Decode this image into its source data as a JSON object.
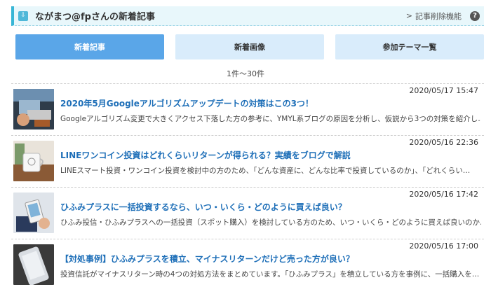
{
  "header": {
    "title": "ながまつ@fpさんの新着記事",
    "delete_link": "記事削除機能",
    "help": "?",
    "arrow": ">"
  },
  "tabs": [
    {
      "label": "新着記事",
      "active": true
    },
    {
      "label": "新着画像",
      "active": false
    },
    {
      "label": "参加テーマ一覧",
      "active": false
    }
  ],
  "range_text": "1件〜30件",
  "articles": [
    {
      "date": "2020/05/17 15:47",
      "title": "2020年5月Googleアルゴリズムアップデートの対策はこの3つ！",
      "desc": "Googleアルゴリズム変更で大きくアクセス下落した方の参考に、YMYL系ブログの原因を分析し、仮説から3つの対策を紹介し…"
    },
    {
      "date": "2020/05/16 22:36",
      "title": "LINEワンコイン投資はどれくらいリターンが得られる？実績をブログで解説",
      "desc": "LINEスマート投資・ワンコイン投資を検討中の方のため、「どんな資産に、どんな比率で投資しているのか」、「どれくらい…"
    },
    {
      "date": "2020/05/16 17:42",
      "title": "ひふみプラスに一括投資するなら、いつ・いくら・どのように買えば良い？",
      "desc": "ひふみ投信・ひふみプラスへの一括投資（スポット購入）を検討している方のため、いつ・いくら・どのように買えば良いのか…"
    },
    {
      "date": "2020/05/16 17:00",
      "title": "【対処事例】ひふみプラスを積立、マイナスリターンだけど売った方が良い？",
      "desc": "投資信託がマイナスリターン時の4つの対処方法をまとめています。「ひふみプラス」を積立している方を事例に、一括購入を…"
    }
  ]
}
